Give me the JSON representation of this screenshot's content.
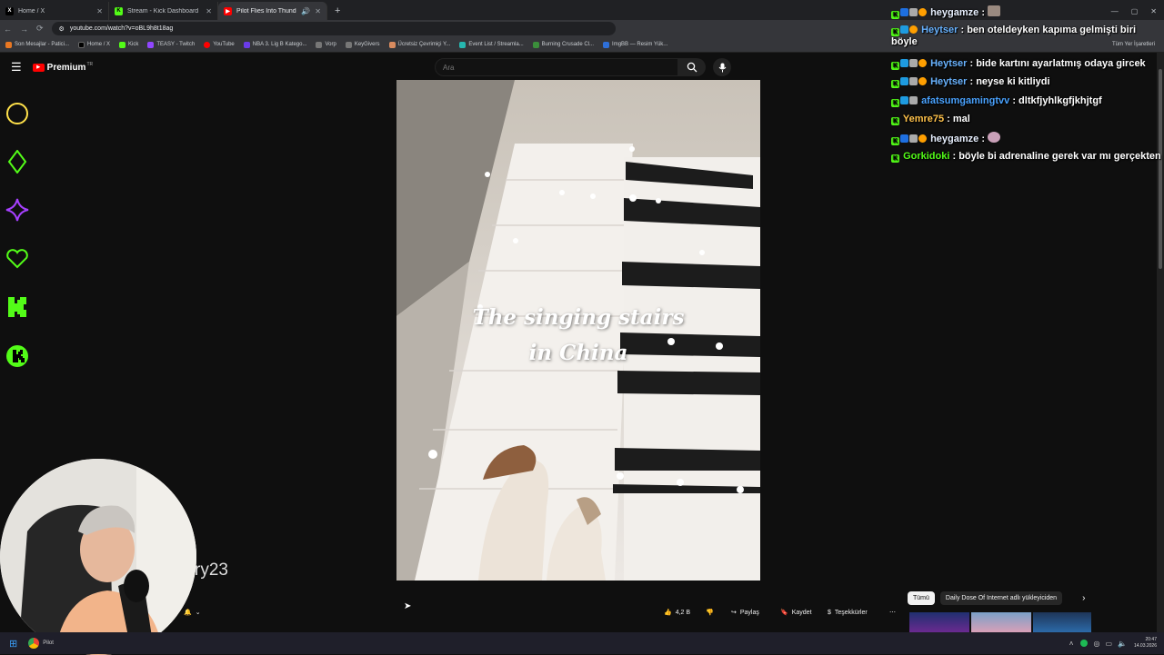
{
  "browser": {
    "tabs": [
      {
        "label": "Home / X",
        "favicon": "X"
      },
      {
        "label": "Stream - Kick Dashboard",
        "favicon": "K"
      },
      {
        "label": "Pilot Flies Into Thunderstor",
        "favicon": "▶"
      }
    ],
    "url": "youtube.com/watch?v=oBL9h8t18ag",
    "bookmarks": [
      "Son Mesajlar - Patici...",
      "Home / X",
      "Kick",
      "TEASY - Twitch",
      "YouTube",
      "NBA 3. Lig B Katego...",
      "Vorp",
      "KeyGivers",
      "Ücretsiz Çevrimiçi Y...",
      "Event List / Streamla...",
      "Burning Crusade Cl...",
      "ImgBB — Resim Yük..."
    ],
    "bookmarks_right": "Tüm Yer İşaretleri"
  },
  "youtube": {
    "logo_text": "Premium",
    "logo_region": "TR",
    "search_placeholder": "Ara",
    "video_caption_line1": "The singing stairs",
    "video_caption_line2": "in China",
    "channel_partial": "ry23",
    "actions": {
      "likes": "4,2 B",
      "share": "Paylaş",
      "save": "Kaydet",
      "thanks": "Teşekkürler"
    },
    "chips": {
      "all": "Tümü",
      "uploader": "Daily Dose Of Internet adlı yükleyiciden"
    }
  },
  "chat": [
    {
      "user": "heygamze",
      "text": "",
      "color": "#e8f0ff",
      "badges": 4,
      "emote": true
    },
    {
      "user": "Heytser",
      "text": "ben oteldeyken kapıma gelmişti biri böyle",
      "color": "#69b3ff",
      "badges": 3
    },
    {
      "user": "Heytser",
      "text": "bide kartını ayarlatmış odaya gircek",
      "color": "#69b3ff",
      "badges": 3
    },
    {
      "user": "Heytser",
      "text": "neyse ki kitliydi",
      "color": "#69b3ff",
      "badges": 3
    },
    {
      "user": "afatsumgamingtvv",
      "text": "dltkfjyhlkgfjkhjtgf",
      "color": "#4aa3ff",
      "badges": 3
    },
    {
      "user": "Yemre75",
      "text": "mal",
      "color": "#ffc24b",
      "badges": 1
    },
    {
      "user": "heygamze",
      "text": "",
      "color": "#e8f0ff",
      "badges": 4,
      "emote": true
    },
    {
      "user": "Gorkidoki",
      "text": "böyle bi adrenaline gerek var mı gerçekten",
      "color": "#53fc18",
      "badges": 1
    }
  ],
  "taskbar": {
    "time": "20:47",
    "date": "14.03.2026",
    "app_label": "Pilot"
  },
  "colors": {
    "kick_green": "#53fc18",
    "yt_red": "#ff0000"
  }
}
